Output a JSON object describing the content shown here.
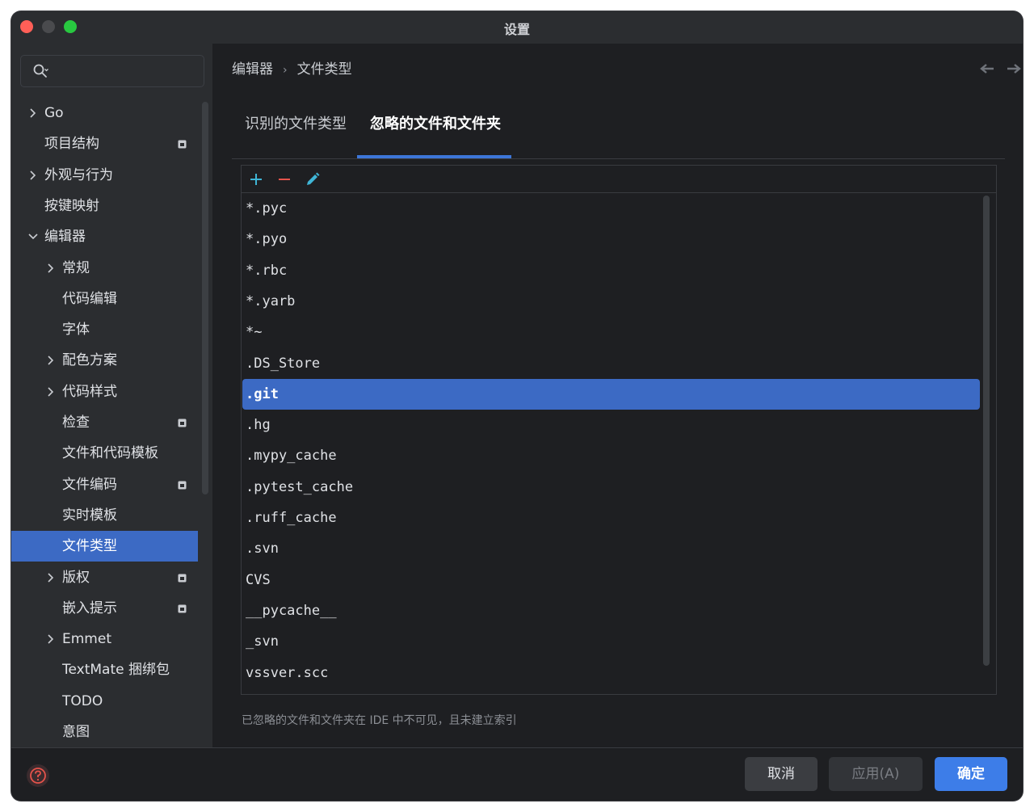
{
  "window": {
    "title": "设置"
  },
  "sidebar": {
    "search_placeholder": "",
    "items": [
      {
        "label": "Go",
        "expandable": true,
        "expanded": false,
        "indent": 0,
        "badge": false,
        "selected": false
      },
      {
        "label": "项目结构",
        "expandable": false,
        "indent": 0,
        "badge": true,
        "selected": false
      },
      {
        "label": "外观与行为",
        "expandable": true,
        "expanded": false,
        "indent": 0,
        "badge": false,
        "selected": false
      },
      {
        "label": "按键映射",
        "expandable": false,
        "indent": 0,
        "badge": false,
        "selected": false
      },
      {
        "label": "编辑器",
        "expandable": true,
        "expanded": true,
        "indent": 0,
        "badge": false,
        "selected": false
      },
      {
        "label": "常规",
        "expandable": true,
        "expanded": false,
        "indent": 1,
        "badge": false,
        "selected": false
      },
      {
        "label": "代码编辑",
        "expandable": false,
        "indent": 1,
        "badge": false,
        "selected": false
      },
      {
        "label": "字体",
        "expandable": false,
        "indent": 1,
        "badge": false,
        "selected": false
      },
      {
        "label": "配色方案",
        "expandable": true,
        "expanded": false,
        "indent": 1,
        "badge": false,
        "selected": false
      },
      {
        "label": "代码样式",
        "expandable": true,
        "expanded": false,
        "indent": 1,
        "badge": false,
        "selected": false
      },
      {
        "label": "检查",
        "expandable": false,
        "indent": 1,
        "badge": true,
        "selected": false
      },
      {
        "label": "文件和代码模板",
        "expandable": false,
        "indent": 1,
        "badge": false,
        "selected": false
      },
      {
        "label": "文件编码",
        "expandable": false,
        "indent": 1,
        "badge": true,
        "selected": false
      },
      {
        "label": "实时模板",
        "expandable": false,
        "indent": 1,
        "badge": false,
        "selected": false
      },
      {
        "label": "文件类型",
        "expandable": false,
        "indent": 1,
        "badge": false,
        "selected": true
      },
      {
        "label": "版权",
        "expandable": true,
        "expanded": false,
        "indent": 1,
        "badge": true,
        "selected": false
      },
      {
        "label": "嵌入提示",
        "expandable": false,
        "indent": 1,
        "badge": true,
        "selected": false
      },
      {
        "label": "Emmet",
        "expandable": true,
        "expanded": false,
        "indent": 1,
        "badge": false,
        "selected": false
      },
      {
        "label": "TextMate 捆绑包",
        "expandable": false,
        "indent": 1,
        "badge": false,
        "selected": false
      },
      {
        "label": "TODO",
        "expandable": false,
        "indent": 1,
        "badge": false,
        "selected": false
      },
      {
        "label": "意图",
        "expandable": false,
        "indent": 1,
        "badge": false,
        "selected": false
      }
    ]
  },
  "breadcrumb": {
    "parent": "编辑器",
    "separator": "›",
    "current": "文件类型"
  },
  "tabs": [
    {
      "label": "识别的文件类型",
      "active": false
    },
    {
      "label": "忽略的文件和文件夹",
      "active": true
    }
  ],
  "toolbar": {
    "add_icon": "plus-icon",
    "remove_icon": "minus-icon",
    "edit_icon": "pencil-icon"
  },
  "ignored_list": [
    {
      "value": "*.pyc",
      "selected": false
    },
    {
      "value": "*.pyo",
      "selected": false
    },
    {
      "value": "*.rbc",
      "selected": false
    },
    {
      "value": "*.yarb",
      "selected": false
    },
    {
      "value": "*~",
      "selected": false
    },
    {
      "value": ".DS_Store",
      "selected": false
    },
    {
      "value": ".git",
      "selected": true
    },
    {
      "value": ".hg",
      "selected": false
    },
    {
      "value": ".mypy_cache",
      "selected": false
    },
    {
      "value": ".pytest_cache",
      "selected": false
    },
    {
      "value": ".ruff_cache",
      "selected": false
    },
    {
      "value": ".svn",
      "selected": false
    },
    {
      "value": "CVS",
      "selected": false
    },
    {
      "value": "__pycache__",
      "selected": false
    },
    {
      "value": "_svn",
      "selected": false
    },
    {
      "value": "vssver.scc",
      "selected": false
    }
  ],
  "hint": "已忽略的文件和文件夹在 IDE 中不可见，且未建立索引",
  "footer": {
    "help_icon": "help-icon",
    "cancel_label": "取消",
    "apply_label": "应用(A)",
    "ok_label": "确定"
  },
  "colors": {
    "accent": "#3d7de8",
    "selection": "#3c6ac4",
    "add": "#3fb5d6",
    "remove": "#e5534b",
    "edit": "#3fb5d6"
  }
}
